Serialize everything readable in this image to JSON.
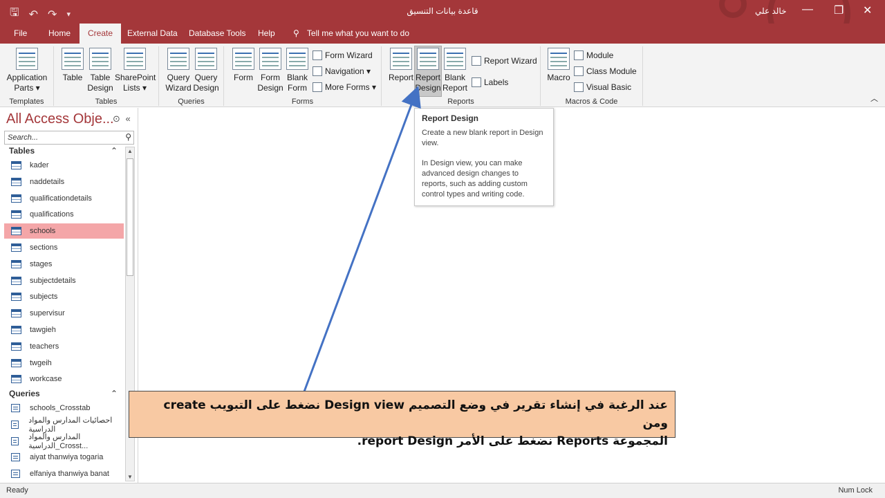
{
  "window": {
    "title": "قاعدة بيانات التنسيق",
    "user": "خالد علي",
    "qat": {
      "save": "🖫",
      "undo": "↶",
      "redo": "↷",
      "customize": "▾"
    },
    "controls": {
      "minimize": "—",
      "restore": "❐",
      "close": "✕"
    }
  },
  "tabs": [
    {
      "label": "File"
    },
    {
      "label": "Home"
    },
    {
      "label": "Create"
    },
    {
      "label": "External Data"
    },
    {
      "label": "Database Tools"
    },
    {
      "label": "Help"
    }
  ],
  "tell_me": "Tell me what you want to do",
  "ribbon": {
    "groups": {
      "templates": "Templates",
      "tables": "Tables",
      "queries": "Queries",
      "forms": "Forms",
      "reports": "Reports",
      "macros": "Macros & Code"
    },
    "buttons": {
      "app_parts": "Application Parts ▾",
      "table": "Table",
      "table_design": "Table Design",
      "sharepoint": "SharePoint Lists ▾",
      "query_wizard": "Query Wizard",
      "query_design": "Query Design",
      "form": "Form",
      "form_design": "Form Design",
      "blank_form": "Blank Form",
      "form_wizard": "Form Wizard",
      "navigation": "Navigation ▾",
      "more_forms": "More Forms ▾",
      "report": "Report",
      "report_design": "Report Design",
      "blank_report": "Blank Report",
      "report_wizard": "Report Wizard",
      "labels": "Labels",
      "macro": "Macro",
      "module": "Module",
      "class_module": "Class Module",
      "visual_basic": "Visual Basic"
    }
  },
  "nav": {
    "title": "All Access Obje...",
    "search_placeholder": "Search...",
    "tables_header": "Tables",
    "queries_header": "Queries",
    "tables": [
      "kader",
      "naddetails",
      "qualificationdetails",
      "qualifications",
      "schools",
      "sections",
      "stages",
      "subjectdetails",
      "subjects",
      "supervisur",
      "tawgieh",
      "teachers",
      "twgeih",
      "workcase"
    ],
    "selected_table": "schools",
    "queries": [
      "schools_Crosstab",
      "احصائيات المدارس والمواد الدراسية",
      "المدارس والمواد الدراسية_Crosst...",
      "aiyat thanwiya togaria",
      "elfaniya thanwiya banat"
    ]
  },
  "tooltip": {
    "title": "Report Design",
    "line1": "Create a new blank report in Design view.",
    "line2": "In Design view, you can make advanced design changes to reports, such as adding custom control types and writing code."
  },
  "annotation": {
    "line1": "عند الرغبة في إنشاء تقرير في وضع التصميم Design view نضغط على التبويب create ومن",
    "line2": "المجموعة Reports نضغط على الأمر report Design."
  },
  "status": {
    "left": "Ready",
    "right": "Num Lock"
  },
  "colors": {
    "accent": "#a4373a",
    "selected_item": "#f4a6a8",
    "callout": "#f8c9a3",
    "arrow": "#4472c4"
  }
}
